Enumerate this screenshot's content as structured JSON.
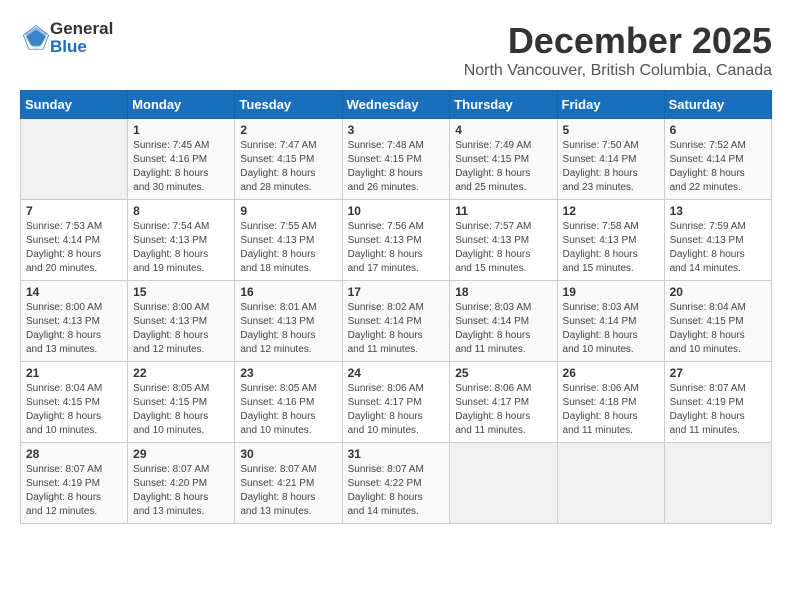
{
  "logo": {
    "general": "General",
    "blue": "Blue"
  },
  "header": {
    "month": "December 2025",
    "location": "North Vancouver, British Columbia, Canada"
  },
  "days_of_week": [
    "Sunday",
    "Monday",
    "Tuesday",
    "Wednesday",
    "Thursday",
    "Friday",
    "Saturday"
  ],
  "weeks": [
    [
      {
        "day": "",
        "info": ""
      },
      {
        "day": "1",
        "info": "Sunrise: 7:45 AM\nSunset: 4:16 PM\nDaylight: 8 hours\nand 30 minutes."
      },
      {
        "day": "2",
        "info": "Sunrise: 7:47 AM\nSunset: 4:15 PM\nDaylight: 8 hours\nand 28 minutes."
      },
      {
        "day": "3",
        "info": "Sunrise: 7:48 AM\nSunset: 4:15 PM\nDaylight: 8 hours\nand 26 minutes."
      },
      {
        "day": "4",
        "info": "Sunrise: 7:49 AM\nSunset: 4:15 PM\nDaylight: 8 hours\nand 25 minutes."
      },
      {
        "day": "5",
        "info": "Sunrise: 7:50 AM\nSunset: 4:14 PM\nDaylight: 8 hours\nand 23 minutes."
      },
      {
        "day": "6",
        "info": "Sunrise: 7:52 AM\nSunset: 4:14 PM\nDaylight: 8 hours\nand 22 minutes."
      }
    ],
    [
      {
        "day": "7",
        "info": "Sunrise: 7:53 AM\nSunset: 4:14 PM\nDaylight: 8 hours\nand 20 minutes."
      },
      {
        "day": "8",
        "info": "Sunrise: 7:54 AM\nSunset: 4:13 PM\nDaylight: 8 hours\nand 19 minutes."
      },
      {
        "day": "9",
        "info": "Sunrise: 7:55 AM\nSunset: 4:13 PM\nDaylight: 8 hours\nand 18 minutes."
      },
      {
        "day": "10",
        "info": "Sunrise: 7:56 AM\nSunset: 4:13 PM\nDaylight: 8 hours\nand 17 minutes."
      },
      {
        "day": "11",
        "info": "Sunrise: 7:57 AM\nSunset: 4:13 PM\nDaylight: 8 hours\nand 15 minutes."
      },
      {
        "day": "12",
        "info": "Sunrise: 7:58 AM\nSunset: 4:13 PM\nDaylight: 8 hours\nand 15 minutes."
      },
      {
        "day": "13",
        "info": "Sunrise: 7:59 AM\nSunset: 4:13 PM\nDaylight: 8 hours\nand 14 minutes."
      }
    ],
    [
      {
        "day": "14",
        "info": "Sunrise: 8:00 AM\nSunset: 4:13 PM\nDaylight: 8 hours\nand 13 minutes."
      },
      {
        "day": "15",
        "info": "Sunrise: 8:00 AM\nSunset: 4:13 PM\nDaylight: 8 hours\nand 12 minutes."
      },
      {
        "day": "16",
        "info": "Sunrise: 8:01 AM\nSunset: 4:13 PM\nDaylight: 8 hours\nand 12 minutes."
      },
      {
        "day": "17",
        "info": "Sunrise: 8:02 AM\nSunset: 4:14 PM\nDaylight: 8 hours\nand 11 minutes."
      },
      {
        "day": "18",
        "info": "Sunrise: 8:03 AM\nSunset: 4:14 PM\nDaylight: 8 hours\nand 11 minutes."
      },
      {
        "day": "19",
        "info": "Sunrise: 8:03 AM\nSunset: 4:14 PM\nDaylight: 8 hours\nand 10 minutes."
      },
      {
        "day": "20",
        "info": "Sunrise: 8:04 AM\nSunset: 4:15 PM\nDaylight: 8 hours\nand 10 minutes."
      }
    ],
    [
      {
        "day": "21",
        "info": "Sunrise: 8:04 AM\nSunset: 4:15 PM\nDaylight: 8 hours\nand 10 minutes."
      },
      {
        "day": "22",
        "info": "Sunrise: 8:05 AM\nSunset: 4:15 PM\nDaylight: 8 hours\nand 10 minutes."
      },
      {
        "day": "23",
        "info": "Sunrise: 8:05 AM\nSunset: 4:16 PM\nDaylight: 8 hours\nand 10 minutes."
      },
      {
        "day": "24",
        "info": "Sunrise: 8:06 AM\nSunset: 4:17 PM\nDaylight: 8 hours\nand 10 minutes."
      },
      {
        "day": "25",
        "info": "Sunrise: 8:06 AM\nSunset: 4:17 PM\nDaylight: 8 hours\nand 11 minutes."
      },
      {
        "day": "26",
        "info": "Sunrise: 8:06 AM\nSunset: 4:18 PM\nDaylight: 8 hours\nand 11 minutes."
      },
      {
        "day": "27",
        "info": "Sunrise: 8:07 AM\nSunset: 4:19 PM\nDaylight: 8 hours\nand 11 minutes."
      }
    ],
    [
      {
        "day": "28",
        "info": "Sunrise: 8:07 AM\nSunset: 4:19 PM\nDaylight: 8 hours\nand 12 minutes."
      },
      {
        "day": "29",
        "info": "Sunrise: 8:07 AM\nSunset: 4:20 PM\nDaylight: 8 hours\nand 13 minutes."
      },
      {
        "day": "30",
        "info": "Sunrise: 8:07 AM\nSunset: 4:21 PM\nDaylight: 8 hours\nand 13 minutes."
      },
      {
        "day": "31",
        "info": "Sunrise: 8:07 AM\nSunset: 4:22 PM\nDaylight: 8 hours\nand 14 minutes."
      },
      {
        "day": "",
        "info": ""
      },
      {
        "day": "",
        "info": ""
      },
      {
        "day": "",
        "info": ""
      }
    ]
  ]
}
